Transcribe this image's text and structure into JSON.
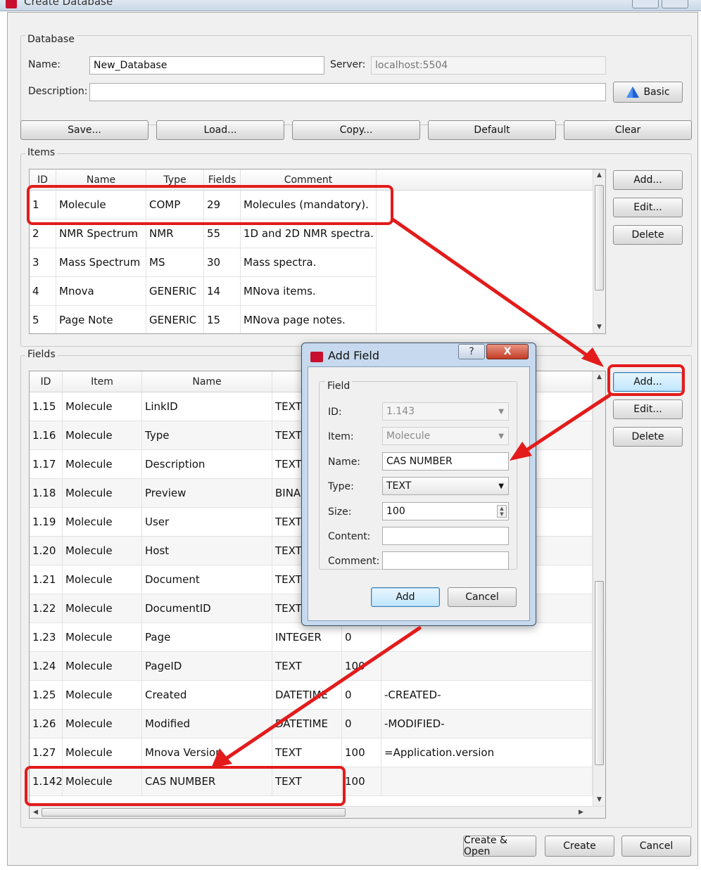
{
  "window": {
    "title": "Create Database"
  },
  "database": {
    "group_title": "Database",
    "name_label": "Name:",
    "name_value": "New_Database",
    "server_label": "Server:",
    "server_placeholder": "localhost:5504",
    "description_label": "Description:",
    "description_value": "",
    "basic_button": "Basic"
  },
  "toolbar": {
    "save": "Save...",
    "load": "Load...",
    "copy": "Copy...",
    "default": "Default",
    "clear": "Clear"
  },
  "items": {
    "group_title": "Items",
    "columns": [
      "ID",
      "Name",
      "Type",
      "Fields",
      "Comment"
    ],
    "rows": [
      [
        "1",
        "Molecule",
        "COMP",
        "29",
        "Molecules (mandatory)."
      ],
      [
        "2",
        "NMR Spectrum",
        "NMR",
        "55",
        "1D and 2D NMR spectra."
      ],
      [
        "3",
        "Mass Spectrum",
        "MS",
        "30",
        "Mass spectra."
      ],
      [
        "4",
        "Mnova",
        "GENERIC",
        "14",
        "MNova items."
      ],
      [
        "5",
        "Page Note",
        "GENERIC",
        "15",
        "MNova page notes."
      ]
    ],
    "add": "Add...",
    "edit": "Edit...",
    "delete": "Delete"
  },
  "fields": {
    "group_title": "Fields",
    "columns": [
      "ID",
      "Item",
      "Name",
      "T",
      "",
      ""
    ],
    "rows": [
      [
        "1.15",
        "Molecule",
        "LinkID",
        "TEXT",
        "",
        ""
      ],
      [
        "1.16",
        "Molecule",
        "Type",
        "TEXT",
        "",
        ""
      ],
      [
        "1.17",
        "Molecule",
        "Description",
        "TEXT",
        "",
        ""
      ],
      [
        "1.18",
        "Molecule",
        "Preview",
        "BINA",
        "",
        ""
      ],
      [
        "1.19",
        "Molecule",
        "User",
        "TEXT",
        "",
        ""
      ],
      [
        "1.20",
        "Molecule",
        "Host",
        "TEXT",
        "",
        ""
      ],
      [
        "1.21",
        "Molecule",
        "Document",
        "TEXT",
        "",
        ""
      ],
      [
        "1.22",
        "Molecule",
        "DocumentID",
        "TEXT",
        "",
        ""
      ],
      [
        "1.23",
        "Molecule",
        "Page",
        "INTEGER",
        "0",
        ""
      ],
      [
        "1.24",
        "Molecule",
        "PageID",
        "TEXT",
        "100",
        ""
      ],
      [
        "1.25",
        "Molecule",
        "Created",
        "DATETIME",
        "0",
        "-CREATED-"
      ],
      [
        "1.26",
        "Molecule",
        "Modified",
        "DATETIME",
        "0",
        "-MODIFIED-"
      ],
      [
        "1.27",
        "Molecule",
        "Mnova Version",
        "TEXT",
        "100",
        "=Application.version"
      ],
      [
        "1.142",
        "Molecule",
        "CAS NUMBER",
        "TEXT",
        "100",
        ""
      ]
    ],
    "add": "Add...",
    "edit": "Edit...",
    "delete": "Delete"
  },
  "dialog": {
    "title": "Add Field",
    "help": "?",
    "close": "X",
    "group_title": "Field",
    "id_label": "ID:",
    "id_value": "1.143",
    "item_label": "Item:",
    "item_value": "Molecule",
    "name_label": "Name:",
    "name_value": "CAS NUMBER",
    "type_label": "Type:",
    "type_value": "TEXT",
    "size_label": "Size:",
    "size_value": "100",
    "content_label": "Content:",
    "content_value": "",
    "comment_label": "Comment:",
    "comment_value": "",
    "add_button": "Add",
    "cancel_button": "Cancel"
  },
  "footer": {
    "create_open": "Create & Open",
    "create": "Create",
    "cancel": "Cancel"
  },
  "colors": {
    "highlight": "#e31b1b",
    "basic_icon": "#1f5fd1",
    "app_icon": "#c8102e"
  }
}
